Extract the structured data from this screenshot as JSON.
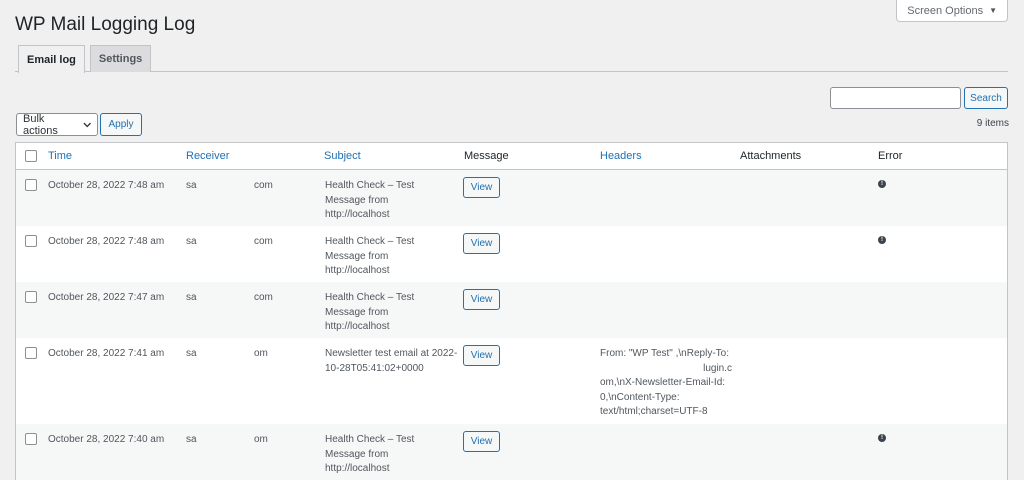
{
  "screen_options": {
    "label": "Screen Options",
    "caret": "▼"
  },
  "page": {
    "title": "WP Mail Logging Log"
  },
  "tabs": [
    {
      "label": "Email log",
      "active": true
    },
    {
      "label": "Settings",
      "active": false
    }
  ],
  "search": {
    "value": "",
    "placeholder": "",
    "button_label": "Search"
  },
  "bulk": {
    "selected": "Bulk actions",
    "apply_label": "Apply"
  },
  "item_count": "9 items",
  "columns": {
    "time": "Time",
    "receiver": "Receiver",
    "subject": "Subject",
    "message": "Message",
    "headers": "Headers",
    "attachments": "Attachments",
    "error": "Error"
  },
  "rows": [
    {
      "time": "October 28, 2022 7:48 am",
      "receiver_start": "sa",
      "receiver_end": "com",
      "subject": "Health Check – Test Message from http://localhost",
      "view_label": "View",
      "headers": "",
      "error": true
    },
    {
      "time": "October 28, 2022 7:48 am",
      "receiver_start": "sa",
      "receiver_end": "com",
      "subject": "Health Check – Test Message from http://localhost",
      "view_label": "View",
      "headers": "",
      "error": true
    },
    {
      "time": "October 28, 2022 7:47 am",
      "receiver_start": "sa",
      "receiver_end": "com",
      "subject": "Health Check – Test Message from http://localhost",
      "view_label": "View",
      "headers": "",
      "error": false
    },
    {
      "time": "October 28, 2022 7:41 am",
      "receiver_start": "sa",
      "receiver_end": "om",
      "subject": "Newsletter test email at 2022-10-28T05:41:02+0000",
      "view_label": "View",
      "headers_lines": [
        "From: \"WP Test\" ,\\nReply-To:",
        "lugin.c",
        "om,\\nX-Newsletter-Email-Id:",
        "0,\\nContent-Type:",
        "text/html;charset=UTF-8"
      ],
      "error": false
    },
    {
      "time": "October 28, 2022 7:40 am",
      "receiver_start": "sa",
      "receiver_end": "om",
      "subject": "Health Check – Test Message from http://localhost",
      "view_label": "View",
      "headers": "",
      "error": true
    }
  ],
  "icons": {
    "error": "exclamation-circle-icon",
    "dropdown": "chevron-down-icon"
  },
  "colors": {
    "accent": "#2271b1",
    "background": "#f0f0f1"
  }
}
